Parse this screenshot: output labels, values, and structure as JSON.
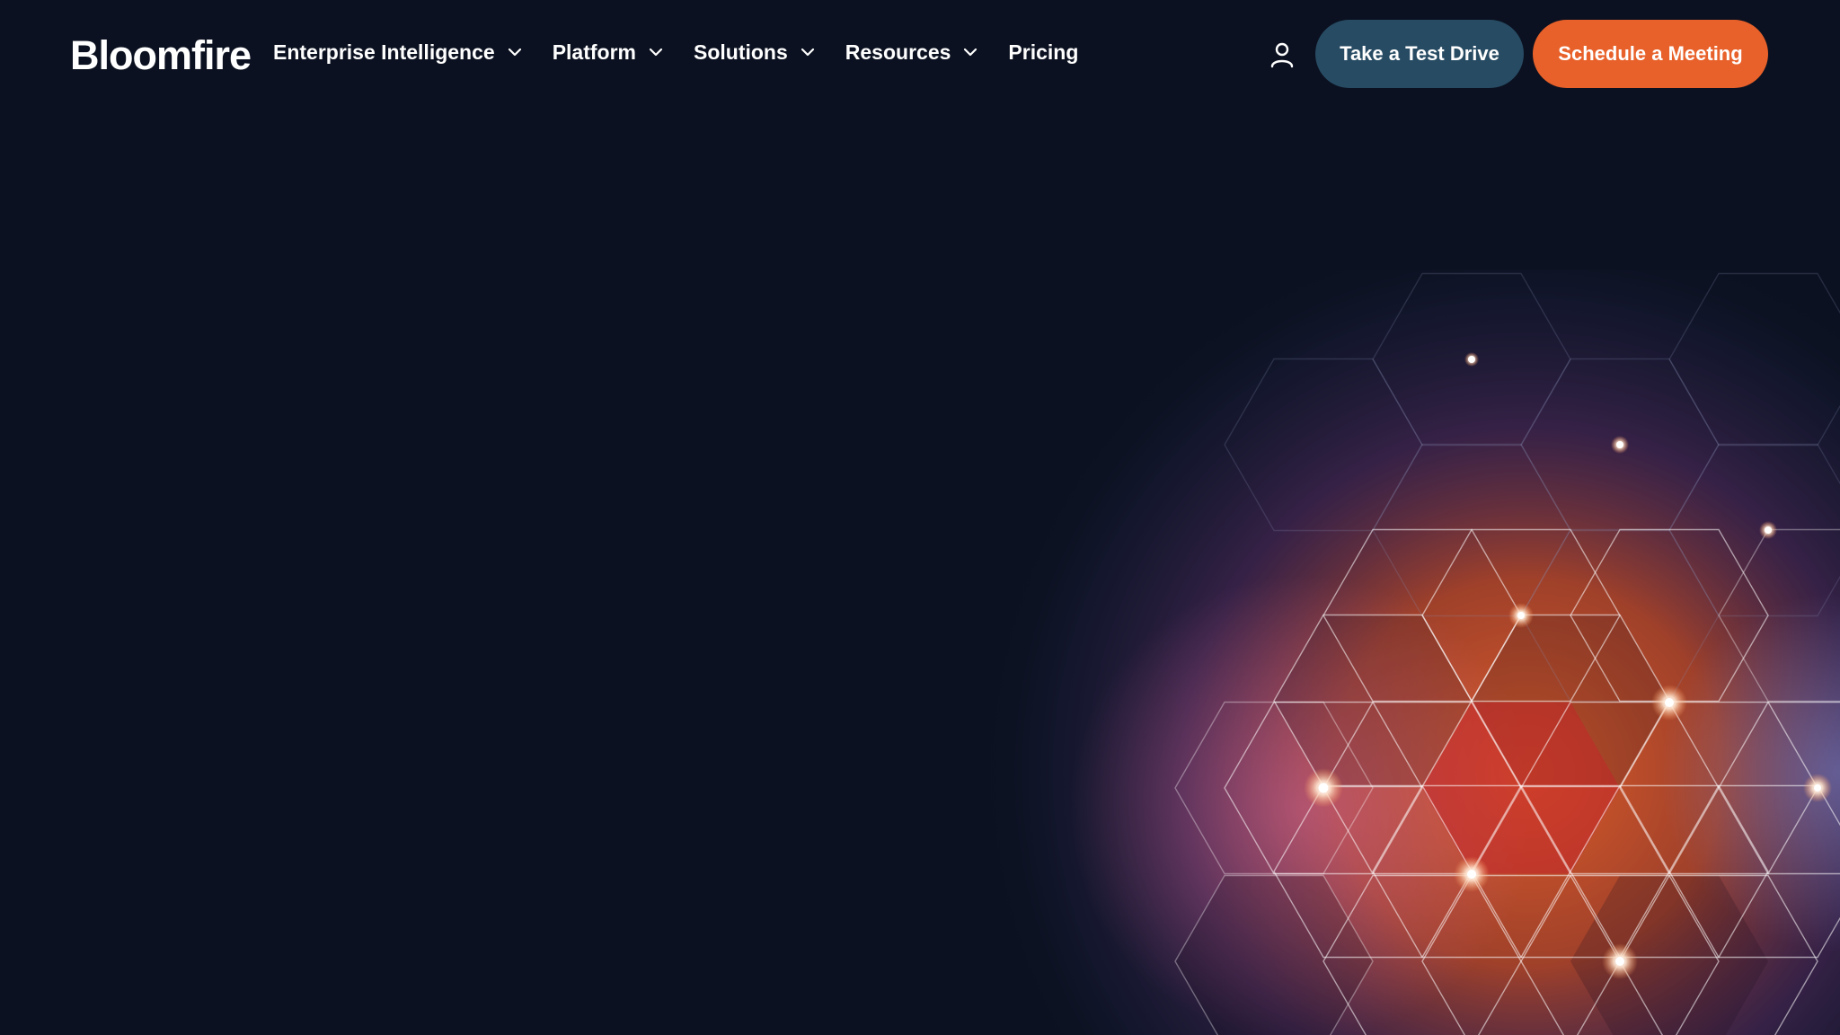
{
  "header": {
    "logo_text": "Bloomfire",
    "nav": [
      {
        "label": "Enterprise Intelligence",
        "has_dropdown": true,
        "icon": "chevron-down-icon"
      },
      {
        "label": "Platform",
        "has_dropdown": true,
        "icon": "chevron-down-icon"
      },
      {
        "label": "Solutions",
        "has_dropdown": true,
        "icon": "chevron-down-icon"
      },
      {
        "label": "Resources",
        "has_dropdown": true,
        "icon": "chevron-down-icon"
      },
      {
        "label": "Pricing",
        "has_dropdown": false
      }
    ],
    "account_icon": "user-icon",
    "test_drive_label": "Take a Test Drive",
    "schedule_label": "Schedule a Meeting"
  },
  "colors": {
    "background": "#0b1120",
    "test_drive_button": "#274b63",
    "schedule_button": "#e8612a",
    "glow_orange": "#e8612a",
    "glow_red": "#c8302a",
    "glow_purple": "#5a3a8a"
  }
}
